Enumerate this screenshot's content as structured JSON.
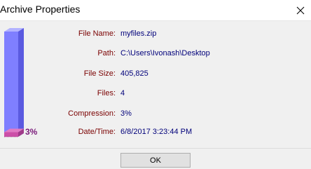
{
  "window": {
    "title": "Archive Properties"
  },
  "gauge": {
    "percent": 3,
    "label": "3%",
    "color": "#8080ff",
    "fill_color": "#cc4fa8"
  },
  "properties": [
    {
      "label": "File Name:",
      "value": "myfiles.zip"
    },
    {
      "label": "Path:",
      "value": "C:\\Users\\Ivonash\\Desktop"
    },
    {
      "label": "File Size:",
      "value": "405,825"
    },
    {
      "label": "Files:",
      "value": "4"
    },
    {
      "label": "Compression:",
      "value": "3%"
    },
    {
      "label": "Date/Time:",
      "value": "6/8/2017 3:23:44 PM"
    }
  ],
  "buttons": {
    "ok": "OK"
  },
  "colors": {
    "label": "#7a0000",
    "value": "#00007a"
  }
}
